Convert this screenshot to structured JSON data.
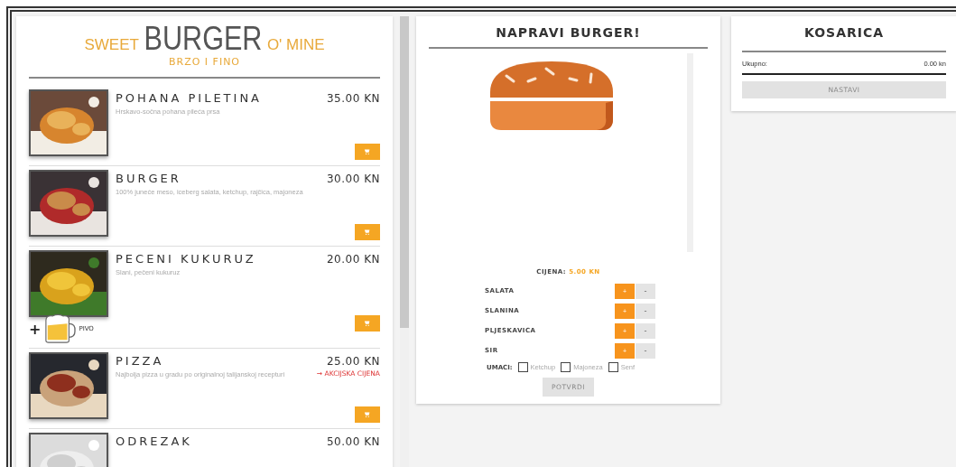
{
  "menu": {
    "logo": {
      "left": "SWEET",
      "main": "BURGER",
      "right": "O' MINE"
    },
    "tagline": "BRZO I FINO",
    "items": [
      {
        "name": "POHANA PILETINA",
        "description": "Hrskavo-sočna pohana pileća prsa",
        "price": "35.00 KN",
        "cart": true
      },
      {
        "name": "BURGER",
        "description": "100% juneće meso, iceberg salata, ketchup, rajčica, majoneza",
        "price": "30.00 KN",
        "cart": true
      },
      {
        "name": "PECENI KUKURUZ",
        "description": "Slani, pečeni kukuruz",
        "price": "20.00 KN",
        "cart": true,
        "addon": {
          "plus": "+",
          "label": "PIVO"
        }
      },
      {
        "name": "PIZZA",
        "description": "Najbolja pizza u gradu po originalnoj talijanskoj recepturi",
        "price": "25.00 KN",
        "note": "→ AKCIJSKA CIJENA",
        "cart": true
      },
      {
        "name": "ODREZAK",
        "price": "50.00 KN"
      }
    ]
  },
  "builder": {
    "title": "NAPRAVI BURGER!",
    "price_label": "CIJENA:",
    "price": "5.00 KN",
    "ingredients": [
      {
        "name": "SALATA",
        "add": "+",
        "remove": "-"
      },
      {
        "name": "SLANINA",
        "add": "+",
        "remove": "-"
      },
      {
        "name": "PLJESKAVICA",
        "add": "+",
        "remove": "-"
      },
      {
        "name": "SIR",
        "add": "+",
        "remove": "-"
      }
    ],
    "sauces_label": "UMACI:",
    "sauces": [
      {
        "label": "Ketchup",
        "checked": false
      },
      {
        "label": "Majoneza",
        "checked": false
      },
      {
        "label": "Senf",
        "checked": false
      }
    ],
    "confirm": {
      "label": "POTVRDI",
      "disabled": true
    }
  },
  "cart": {
    "title": "KOSARICA",
    "total_label": "Ukupno:",
    "total": "0.00 kn",
    "button": {
      "label": "NASTAVI",
      "disabled": true
    }
  }
}
